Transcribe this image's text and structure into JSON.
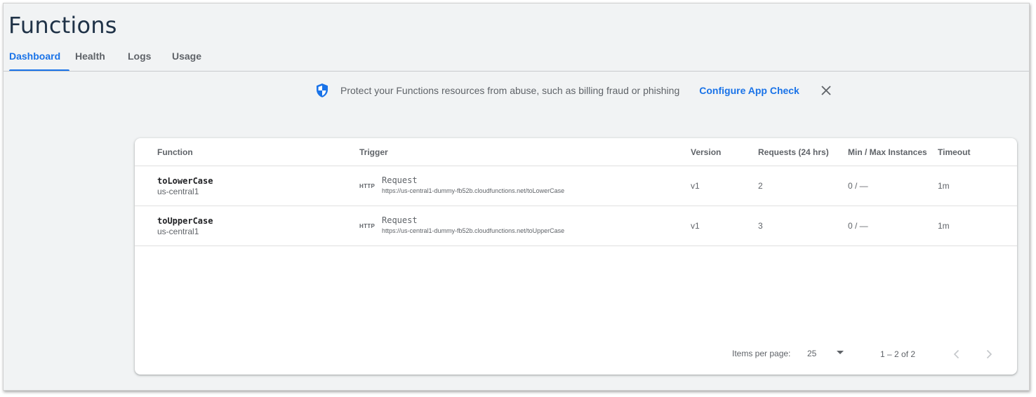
{
  "page": {
    "title": "Functions"
  },
  "tabs": [
    {
      "label": "Dashboard",
      "active": true
    },
    {
      "label": "Health",
      "active": false
    },
    {
      "label": "Logs",
      "active": false
    },
    {
      "label": "Usage",
      "active": false
    }
  ],
  "banner": {
    "icon": "shield-icon",
    "text": "Protect your Functions resources from abuse, such as billing fraud or phishing",
    "link_label": "Configure App Check",
    "close_icon": "close-icon"
  },
  "table": {
    "headers": {
      "function": "Function",
      "trigger": "Trigger",
      "version": "Version",
      "requests": "Requests (24 hrs)",
      "instances": "Min / Max Instances",
      "timeout": "Timeout"
    },
    "rows": [
      {
        "name": "toLowerCase",
        "region": "us-central1",
        "trigger_badge": "HTTP",
        "trigger_type": "Request",
        "trigger_url": "https://us-central1-dummy-fb52b.cloudfunctions.net/toLowerCase",
        "version": "v1",
        "requests": "2",
        "instances": "0 / —",
        "timeout": "1m"
      },
      {
        "name": "toUpperCase",
        "region": "us-central1",
        "trigger_badge": "HTTP",
        "trigger_type": "Request",
        "trigger_url": "https://us-central1-dummy-fb52b.cloudfunctions.net/toUpperCase",
        "version": "v1",
        "requests": "3",
        "instances": "0 / —",
        "timeout": "1m"
      }
    ]
  },
  "pagination": {
    "items_per_page_label": "Items per page:",
    "items_per_page_value": "25",
    "range": "1 – 2 of 2"
  },
  "colors": {
    "accent": "#1a73e8",
    "title": "#1f3247",
    "muted": "#5f6368",
    "background": "#f1f3f4"
  }
}
